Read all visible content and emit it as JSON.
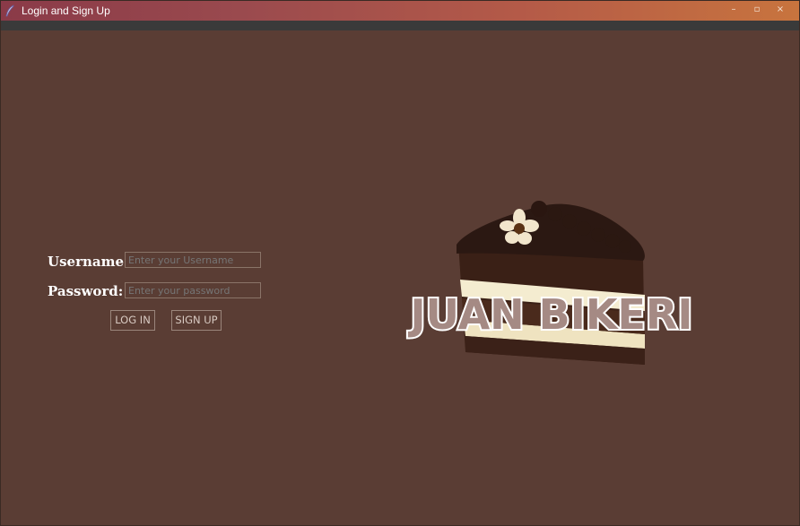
{
  "window": {
    "title": "Login and Sign Up",
    "controls": {
      "minimize": "–",
      "maximize": "▫",
      "close": "×"
    }
  },
  "form": {
    "username_label": "Username:",
    "username_placeholder": "Enter your Username",
    "password_label": "Password:",
    "password_placeholder": "Enter your password",
    "login_label": "LOG IN",
    "signup_label": "SIGN UP"
  },
  "logo": {
    "text": "JUAN BIKERI",
    "icon": "cake-slice-icon"
  },
  "colors": {
    "background": "#5a3d34",
    "titlebar_start": "#8a3a48",
    "titlebar_end": "#c8743e",
    "label": "#ffffff"
  }
}
